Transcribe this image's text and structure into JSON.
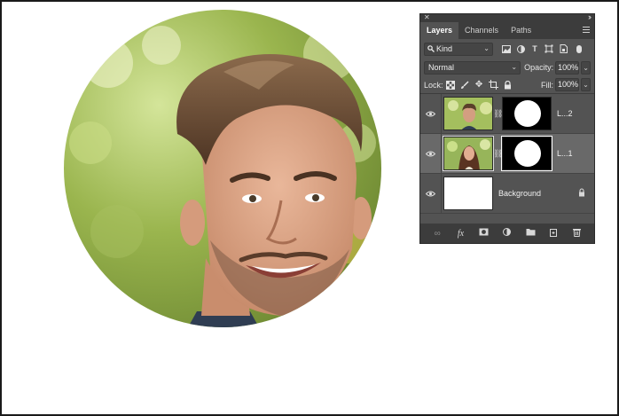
{
  "panel": {
    "tabs": [
      {
        "label": "Layers",
        "active": true
      },
      {
        "label": "Channels",
        "active": false
      },
      {
        "label": "Paths",
        "active": false
      }
    ],
    "filter_kind": "Kind",
    "blend_mode": "Normal",
    "opacity_label": "Opacity:",
    "opacity_value": "100%",
    "lock_label": "Lock:",
    "fill_label": "Fill:",
    "fill_value": "100%",
    "layers": [
      {
        "name": "L...2",
        "thumb": "man-photo",
        "has_mask": true,
        "selected": false
      },
      {
        "name": "L...1",
        "thumb": "woman-photo",
        "has_mask": true,
        "selected": true
      },
      {
        "name": "Background",
        "thumb": "white",
        "has_mask": false,
        "locked": true,
        "selected": false
      }
    ]
  },
  "colors": {
    "panel_bg": "#535353",
    "panel_dark": "#3c3c3c",
    "selected_layer": "#696969"
  },
  "icons": [
    "close-icon",
    "collapse-icon",
    "panel-menu-icon",
    "search-icon",
    "pixel-filter-icon",
    "adjustment-filter-icon",
    "type-filter-icon",
    "shape-filter-icon",
    "smart-object-filter-icon",
    "filter-toggle-icon",
    "lock-transparency-icon",
    "lock-paint-icon",
    "lock-position-icon",
    "lock-artboard-icon",
    "lock-all-icon",
    "eye-icon",
    "chain-link-icon",
    "link-layers-icon",
    "fx-icon",
    "add-mask-icon",
    "adjustment-layer-icon",
    "new-group-icon",
    "new-layer-icon",
    "trash-icon"
  ]
}
